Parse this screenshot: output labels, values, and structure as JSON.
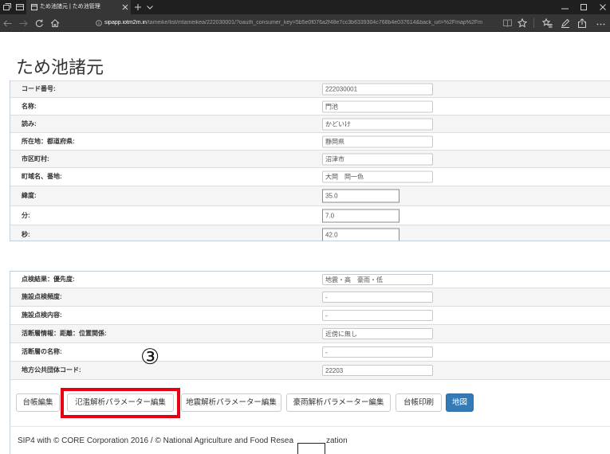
{
  "browser": {
    "tab_title": "ため池諸元 | ため池管理",
    "url_host": "sipapp.iotm2m.in",
    "url_rest": "/tameike/list/mtameikea/222030001/?oauth_consumer_key=5b5e0f076a2f48e7cc3b6339304c768b4e037614&back_url=%2Fmap%2Fm",
    "icons": [
      "set-aside-tabs-icon",
      "tab-preview-icon",
      "page-icon",
      "close-tab-icon",
      "new-tab-icon",
      "tab-list-chevron-icon",
      "minimize-icon",
      "maximize-icon",
      "close-window-icon",
      "back-icon",
      "forward-icon",
      "refresh-icon",
      "home-icon",
      "site-info-icon",
      "reading-view-icon",
      "favorite-star-icon",
      "favorites-hub-icon",
      "web-note-pen-icon",
      "share-icon",
      "more-icon"
    ]
  },
  "page": {
    "title": "ため池諸元",
    "fields_top": [
      {
        "label": "コード番号:",
        "value": "222030001"
      },
      {
        "label": "名称:",
        "value": "門池"
      },
      {
        "label": "読み:",
        "value": "かどいけ"
      },
      {
        "label": "所在地：都道府県:",
        "value": "静岡県"
      },
      {
        "label": "市区町村:",
        "value": "沼津市"
      },
      {
        "label": "町域名、番地:",
        "value": "大岡　岡一色"
      },
      {
        "label": "緯度:",
        "value": "35.0"
      },
      {
        "label": "分:",
        "value": "7.0"
      },
      {
        "label": "秒:",
        "value": "42.0"
      }
    ],
    "fields_bottom": [
      {
        "label": "点検結果：優先度:",
        "value": "地震・高　豪雨・低"
      },
      {
        "label": "施設点検頻度:",
        "value": "-"
      },
      {
        "label": "施設点検内容:",
        "value": "-"
      },
      {
        "label": "活断層情報：距離：位置関係:",
        "value": "近傍に無し"
      },
      {
        "label": "活断層の名称:",
        "value": "-"
      },
      {
        "label": "地方公共団体コード:",
        "value": "22203"
      }
    ],
    "buttons": [
      "台帳編集",
      "氾濫解析パラメーター編集",
      "地震解析パラメーター編集",
      "豪雨解析パラメーター編集",
      "台帳印刷",
      "地図"
    ],
    "footer": {
      "text_before": "SIP4 with © CORE Corporation 2016 / © National Agriculture and Food Resea",
      "text_after": "zation"
    }
  },
  "annotation": {
    "step_marker": "③",
    "highlighted_button_index": 1
  },
  "colors": {
    "titlebar_bg": "#1f1f1f",
    "toolbar_bg": "#363636",
    "row_stripe": "#f5f5f5",
    "primary_button": "#337ab7",
    "highlight_frame": "#e60012"
  }
}
